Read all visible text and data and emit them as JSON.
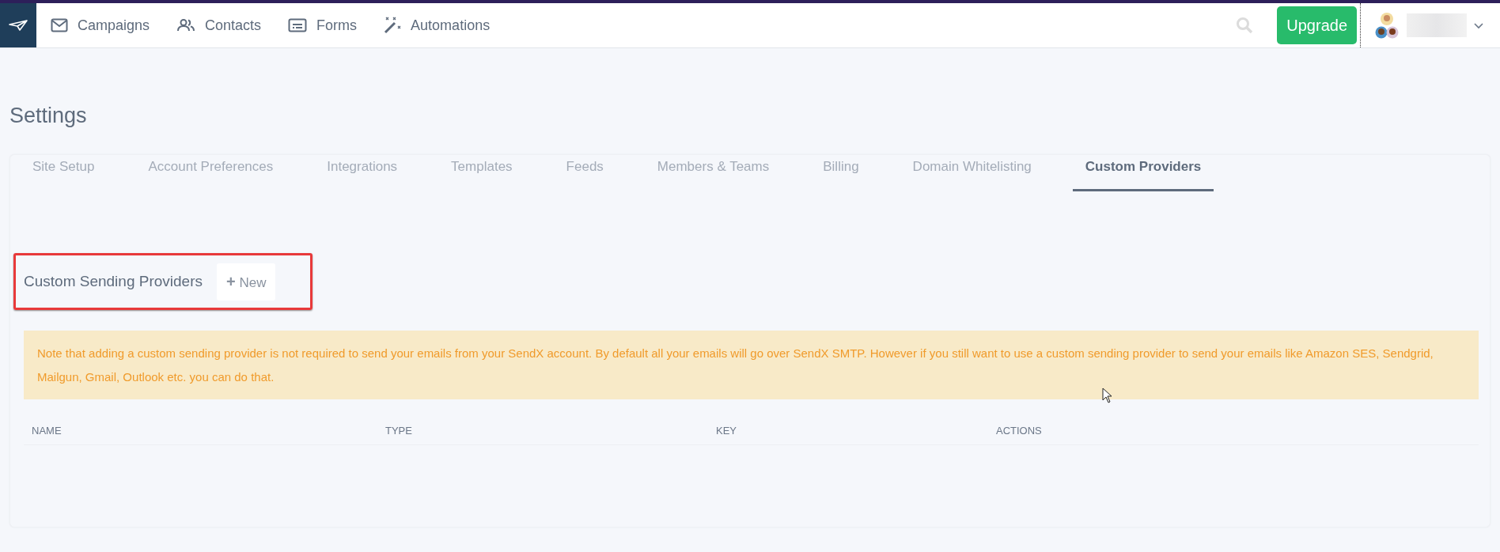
{
  "nav": {
    "items": [
      {
        "kind": "mail",
        "label": "Campaigns"
      },
      {
        "kind": "people",
        "label": "Contacts"
      },
      {
        "kind": "form",
        "label": "Forms"
      },
      {
        "kind": "wand",
        "label": "Automations"
      }
    ],
    "upgrade": "Upgrade"
  },
  "page": {
    "title": "Settings"
  },
  "tabs": [
    {
      "label": "Site Setup",
      "selected": false
    },
    {
      "label": "Account Preferences",
      "selected": false
    },
    {
      "label": "Integrations",
      "selected": false
    },
    {
      "label": "Templates",
      "selected": false
    },
    {
      "label": "Feeds",
      "selected": false
    },
    {
      "label": "Members & Teams",
      "selected": false
    },
    {
      "label": "Billing",
      "selected": false
    },
    {
      "label": "Domain Whitelisting",
      "selected": false
    },
    {
      "label": "Custom Providers",
      "selected": true
    }
  ],
  "section": {
    "title": "Custom Sending Providers",
    "new_button": "New",
    "plus": "+"
  },
  "note": "Note that adding a custom sending provider is not required to send your emails from your SendX account. By default all your emails will go over SendX SMTP. However if you still want to use a custom sending provider to send your emails like Amazon SES, Sendgrid, Mailgun, Gmail, Outlook etc. you can do that.",
  "table": {
    "columns": [
      "NAME",
      "TYPE",
      "KEY",
      "ACTIONS"
    ]
  }
}
